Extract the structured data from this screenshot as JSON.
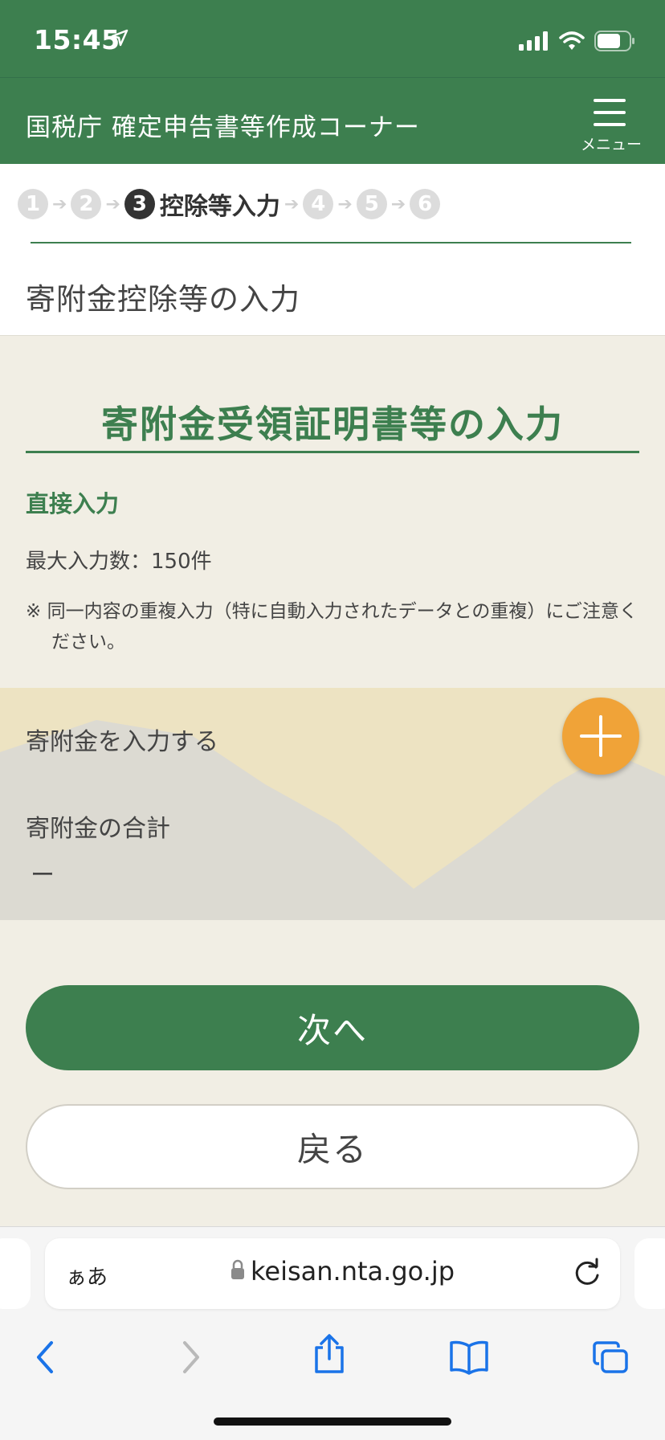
{
  "status": {
    "time": "15:45"
  },
  "header": {
    "title": "国税庁 確定申告書等作成コーナー",
    "menu_label": "メニュー"
  },
  "steps": {
    "items": [
      "1",
      "2",
      "3",
      "4",
      "5",
      "6"
    ],
    "active_index": 3,
    "active_label": "控除等入力"
  },
  "page": {
    "subtitle": "寄附金控除等の入力"
  },
  "section": {
    "heading": "寄附金受領証明書等の入力",
    "direct_input": "直接入力",
    "max_count": "最大入力数：150件",
    "note": "※ 同一内容の重複入力（特に自動入力されたデータとの重複）にご注意ください。"
  },
  "donation": {
    "enter_label": "寄附金を入力する",
    "total_label": "寄附金の合計",
    "total_value": "ー"
  },
  "buttons": {
    "next": "次へ",
    "back": "戻る"
  },
  "browser": {
    "aa": "ぁあ",
    "url": "keisan.nta.go.jp"
  },
  "colors": {
    "brand_green": "#3d7f4f",
    "accent_orange": "#f0a338",
    "background": "#f1eee4"
  }
}
